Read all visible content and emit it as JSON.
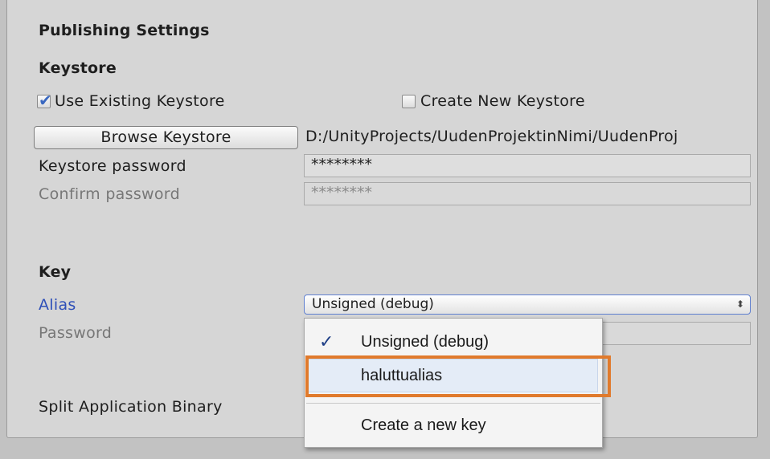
{
  "publishing": {
    "title": "Publishing Settings"
  },
  "keystore": {
    "heading": "Keystore",
    "use_existing_label": "Use Existing Keystore",
    "use_existing_checked": true,
    "create_new_label": "Create New Keystore",
    "create_new_checked": false,
    "browse_label": "Browse Keystore",
    "path": "D:/UnityProjects/UudenProjektinNimi/UudenProj",
    "password_label": "Keystore password",
    "password_value": "********",
    "confirm_label": "Confirm password",
    "confirm_value": "********"
  },
  "key": {
    "heading": "Key",
    "alias_label": "Alias",
    "alias_selected": "Unsigned (debug)",
    "password_label": "Password"
  },
  "split_binary_label": "Split Application Binary",
  "alias_menu": {
    "items": [
      {
        "label": "Unsigned (debug)",
        "checked": true
      },
      {
        "label": "haluttualias",
        "checked": false,
        "highlighted": true
      },
      {
        "label": "Create a new key",
        "checked": false
      }
    ],
    "check_glyph": "✓"
  },
  "colors": {
    "highlight_outline": "#e07a2c",
    "label_active": "#2e4fb8"
  }
}
